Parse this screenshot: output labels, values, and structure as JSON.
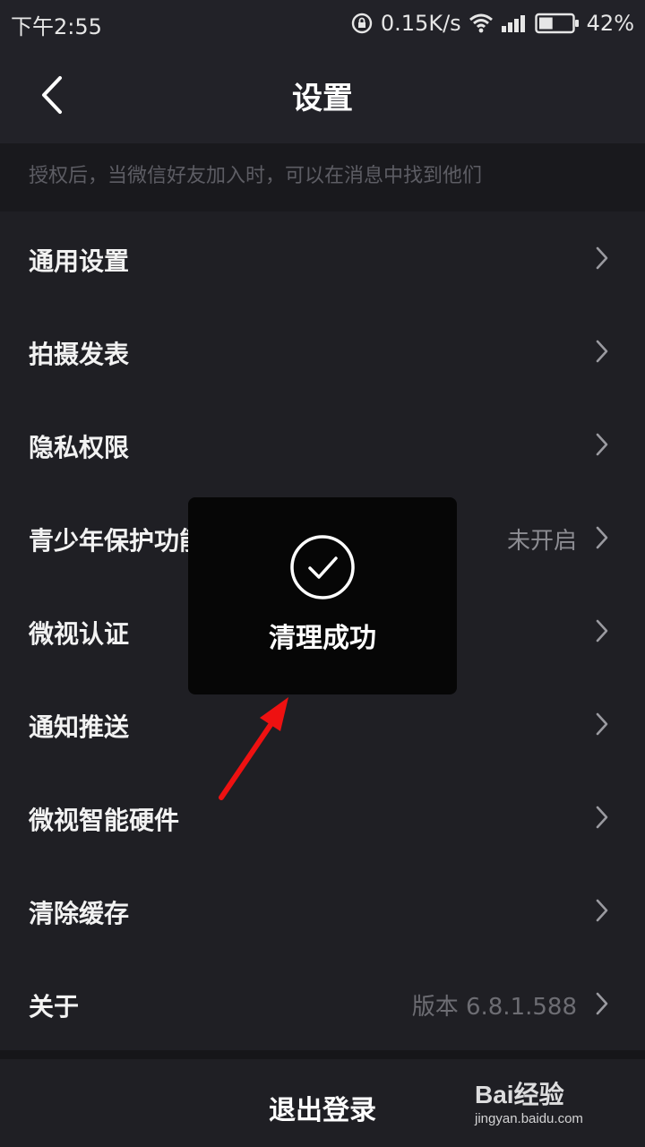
{
  "status_bar": {
    "time": "下午2:55",
    "net_speed": "0.15K/s",
    "battery": "42%",
    "battery_level": 0.42
  },
  "header": {
    "title": "设置",
    "back_icon": "chevron-left-icon"
  },
  "hint": {
    "text": "授权后，当微信好友加入时，可以在消息中找到他们"
  },
  "settings": [
    {
      "label": "通用设置",
      "value": ""
    },
    {
      "label": "拍摄发表",
      "value": ""
    },
    {
      "label": "隐私权限",
      "value": ""
    },
    {
      "label": "青少年保护功能",
      "value": "未开启"
    },
    {
      "label": "微视认证",
      "value": ""
    },
    {
      "label": "通知推送",
      "value": ""
    },
    {
      "label": "微视智能硬件",
      "value": ""
    },
    {
      "label": "清除缓存",
      "value": ""
    },
    {
      "label": "关于",
      "value": "版本 6.8.1.588"
    }
  ],
  "logout": {
    "label": "退出登录"
  },
  "toast": {
    "text": "清理成功",
    "icon": "check-circle-icon"
  },
  "watermark": {
    "logo": "Bai经验",
    "url": "jingyan.baidu.com"
  },
  "colors": {
    "background": "#1f1f24",
    "toast": "#060606",
    "annotation_arrow": "#ee1111"
  }
}
